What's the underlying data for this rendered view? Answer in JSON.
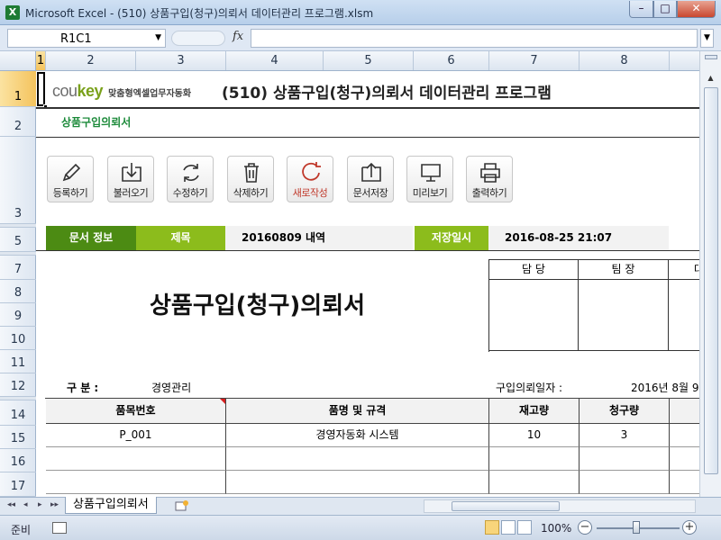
{
  "window": {
    "app_icon": "X",
    "title": "Microsoft Excel - (510) 상품구입(청구)의뢰서 데이터관리 프로그램.xlsm",
    "minimize": "–",
    "maximize": "□",
    "close": "✕"
  },
  "formula_bar": {
    "name_box": "R1C1",
    "fx": "fx",
    "formula": ""
  },
  "columns": [
    "1",
    "2",
    "3",
    "4",
    "5",
    "6",
    "7",
    "8"
  ],
  "rows": [
    "1",
    "2",
    "3",
    "5",
    "7",
    "8",
    "9",
    "10",
    "11",
    "12",
    "14",
    "15",
    "16",
    "17"
  ],
  "sheet": {
    "logo_prefix": "cou",
    "logo_accent": "key",
    "logo_sub": "맞춤형엑셀업무자동화",
    "main_title": "(510) 상품구입(청구)의뢰서 데이터관리 프로그램",
    "subtitle": "상품구입의뢰서",
    "toolbar": [
      {
        "label": "등록하기",
        "icon": "pencil-icon"
      },
      {
        "label": "불러오기",
        "icon": "import-icon"
      },
      {
        "label": "수정하기",
        "icon": "refresh-icon"
      },
      {
        "label": "삭제하기",
        "icon": "trash-icon"
      },
      {
        "label": "새로작성",
        "icon": "new-icon"
      },
      {
        "label": "문서저장",
        "icon": "export-icon"
      },
      {
        "label": "미리보기",
        "icon": "monitor-icon"
      },
      {
        "label": "출력하기",
        "icon": "printer-icon"
      }
    ],
    "info": {
      "doc_info_label": "문서 정보",
      "title_label": "제목",
      "title_value": "20160809 내역",
      "saved_label": "저장일시",
      "saved_value": "2016-08-25 21:07"
    },
    "doc_title": "상품구입(청구)의뢰서",
    "approval": {
      "headers": [
        "담 당",
        "팀 장",
        "대"
      ]
    },
    "fields": {
      "category_label": "구    분 :",
      "category_value": "경영관리",
      "date_label": "구입의뢰일자 :",
      "date_value": "2016년 8월 9"
    },
    "table": {
      "headers": [
        "품목번호",
        "품명 및 규격",
        "재고량",
        "청구량",
        ""
      ],
      "rows": [
        [
          "P_001",
          "경영자동화 시스템",
          "10",
          "3",
          ""
        ],
        [
          "",
          "",
          "",
          "",
          ""
        ],
        [
          "",
          "",
          "",
          "",
          ""
        ]
      ]
    }
  },
  "tabs": {
    "nav": [
      "◂◂",
      "◂",
      "▸",
      "▸▸"
    ],
    "active_sheet": "상품구입의뢰서"
  },
  "status": {
    "ready": "준비",
    "zoom": "100%",
    "zoom_minus": "−",
    "zoom_plus": "+"
  },
  "colors": {
    "accent_dark": "#4c8b13",
    "accent_light": "#8cbc1c",
    "subtitle_green": "#1c8a3a"
  }
}
